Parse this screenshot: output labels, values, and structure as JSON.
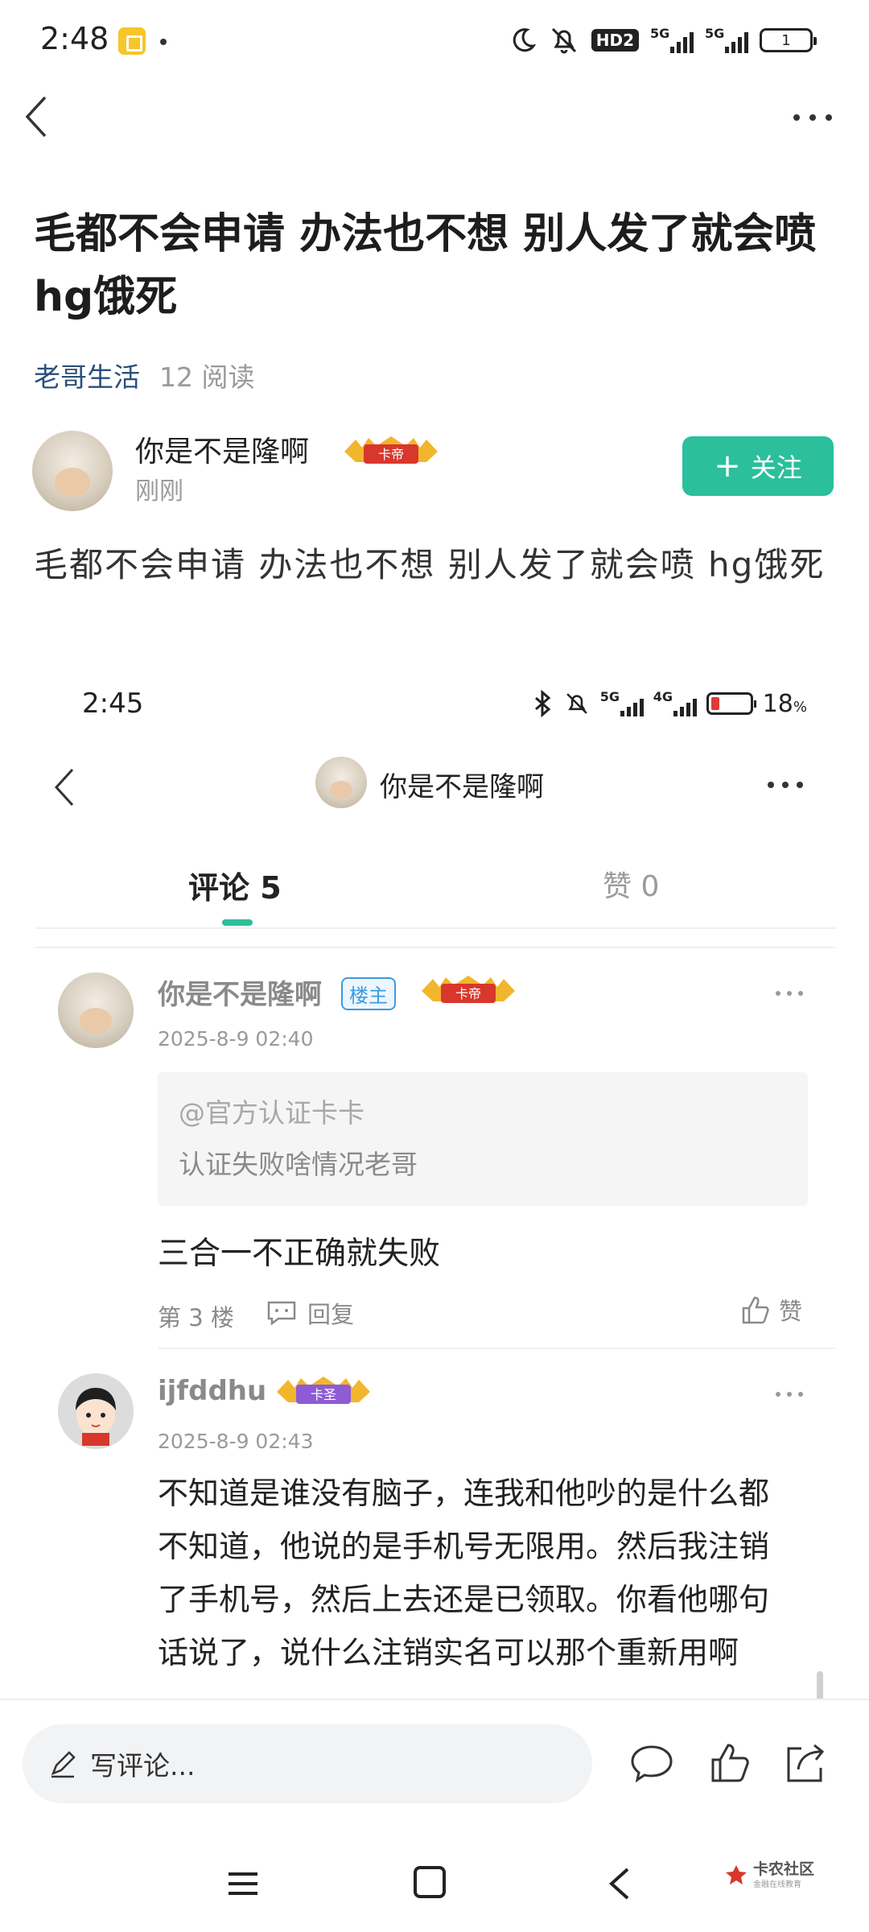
{
  "status_bar": {
    "time": "2:48",
    "hd_label": "HD2",
    "net1": "5G",
    "net2": "5G",
    "battery": "1"
  },
  "post": {
    "title": "毛都不会申请 办法也不想 别人发了就会喷 hg饿死",
    "board": "老哥生活",
    "reads": "12 阅读",
    "author": {
      "name": "你是不是隆啊",
      "badge": "卡帝",
      "time": "刚刚"
    },
    "follow_label": "关注",
    "body": "毛都不会申请  办法也不想  别人发了就会喷  hg饿死"
  },
  "embedded": {
    "status_bar": {
      "time": "2:45",
      "net1": "5G",
      "net2": "4G",
      "battery_pct": "18",
      "pct_sign": "%"
    },
    "nav_title": "你是不是隆啊",
    "tabs": {
      "comments": "评论 5",
      "likes": "赞 0"
    },
    "comments": [
      {
        "name": "你是不是隆啊",
        "owner_tag": "楼主",
        "badge": "卡帝",
        "time": "2025-8-9 02:40",
        "quote_at": "@官方认证卡卡",
        "quote_text": "认证失败啥情况老哥",
        "text": "三合一不正确就失败",
        "floor": "第 3 楼",
        "reply_label": "回复",
        "like_label": "赞"
      },
      {
        "name": "ijfddhu",
        "badge": "卡圣",
        "time": "2025-8-9 02:43",
        "text": "不知道是谁没有脑子，连我和他吵的是什么都不知道，他说的是手机号无限用。然后我注销了手机号，然后上去还是已领取。你看他哪句话说了，说什么注销实名可以那个重新用啊"
      }
    ]
  },
  "bottom_bar": {
    "comment_placeholder": "写评论..."
  },
  "watermark": {
    "title": "卡农社区",
    "subtitle": "金融在线教育"
  },
  "colors": {
    "accent": "#2bbf9b",
    "board_link": "#2a4f78",
    "owner_tag": "#3b9be0",
    "badge_gold": "#e8a11a",
    "badge_red": "#d8372b",
    "badge_purple": "#8e5bd6"
  }
}
